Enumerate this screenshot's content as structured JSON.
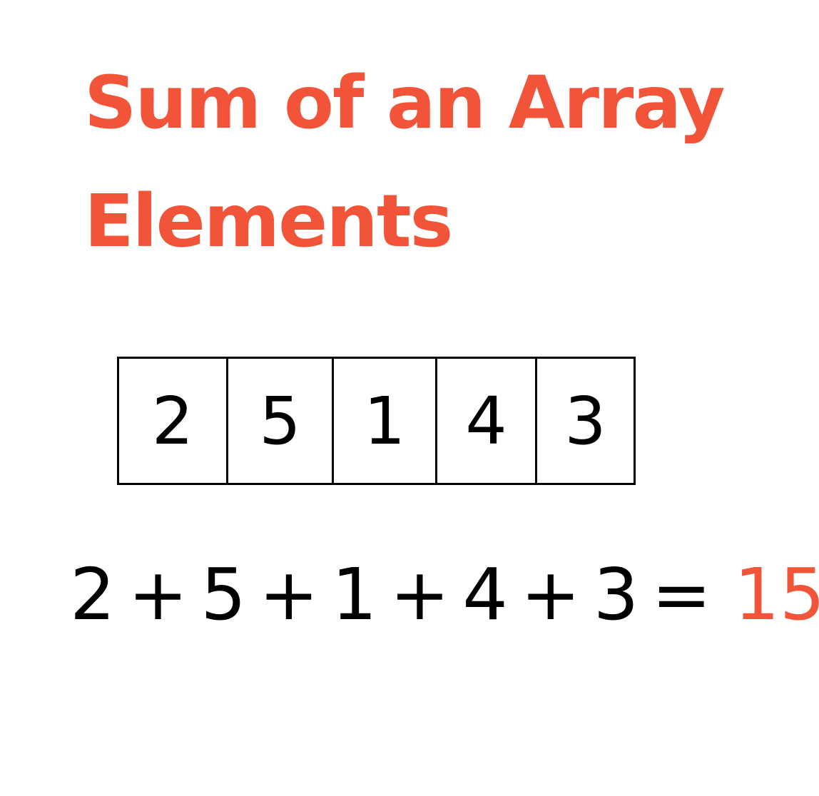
{
  "title": {
    "line1": "Sum of an Array",
    "line2": "Elements"
  },
  "array": {
    "cells": [
      "2",
      "5",
      "1",
      "4",
      "3"
    ]
  },
  "equation": {
    "terms": [
      "2",
      "5",
      "1",
      "4",
      "3"
    ],
    "plus": "+",
    "equals": "=",
    "result": "15"
  },
  "colors": {
    "accent": "#f15439",
    "text": "#000000",
    "background": "#ffffff"
  }
}
